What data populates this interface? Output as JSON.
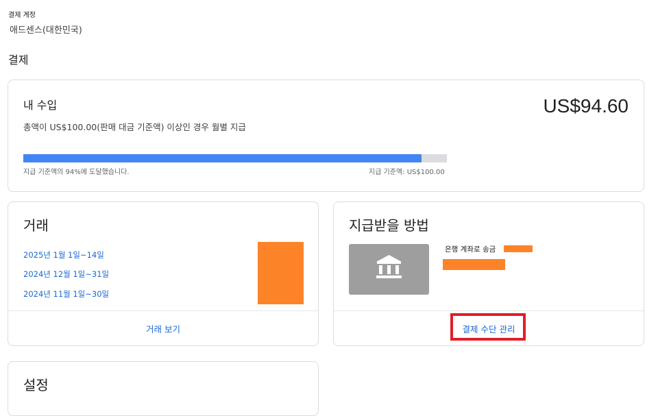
{
  "header": {
    "account_label": "결제 계정",
    "account_name": "애드센스(대한민국)",
    "section_title": "결제"
  },
  "earnings": {
    "title": "내 수입",
    "amount": "US$94.60",
    "description": "총액이 US$100.00(판매 대금 기준액) 이상인 경우 월별 지급",
    "progress_percent": 94,
    "progress_left_text": "지급 기준액의 94%에 도달했습니다.",
    "progress_right_text": "지급 기준액: US$100.00",
    "colors": {
      "fill": "#4285f4",
      "track": "#dadce0"
    }
  },
  "transactions": {
    "title": "거래",
    "items": [
      {
        "label": "2025년 1월 1일~14일"
      },
      {
        "label": "2024년 12월 1일~31일"
      },
      {
        "label": "2024년 11월 1일~30일"
      }
    ],
    "footer_link": "거래 보기"
  },
  "payment_method": {
    "title": "지급받을 방법",
    "icon": "bank-icon",
    "bank_label": "은행 계좌로 송금",
    "footer_link": "결제 수단 관리",
    "highlight_color": "#e01e2b",
    "redaction_color": "#fd8328"
  },
  "settings": {
    "title": "설정"
  }
}
